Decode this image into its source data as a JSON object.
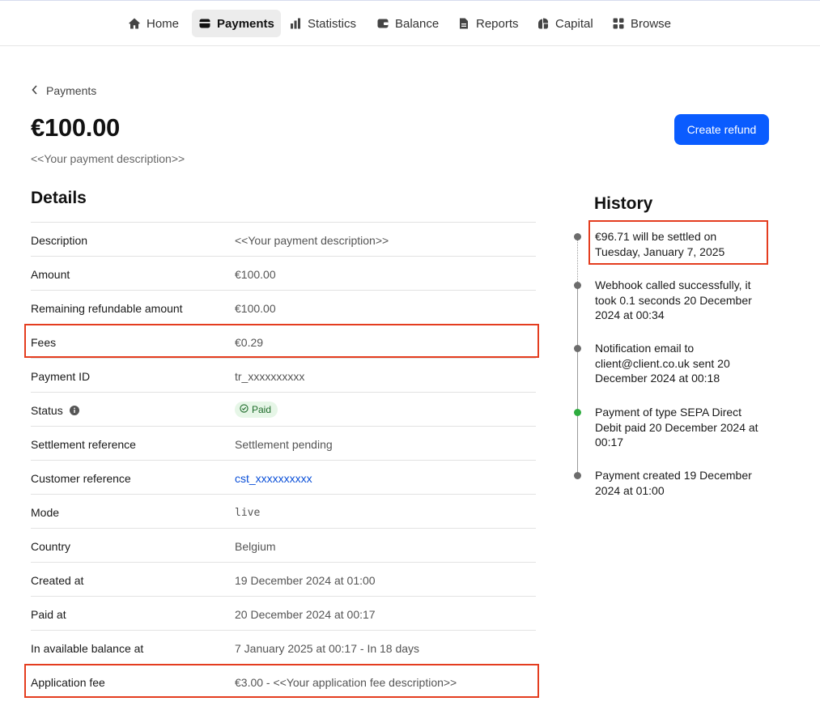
{
  "nav": {
    "items": [
      {
        "label": "Home",
        "icon": "home-icon"
      },
      {
        "label": "Payments",
        "icon": "payments-icon",
        "active": true
      },
      {
        "label": "Statistics",
        "icon": "statistics-icon"
      },
      {
        "label": "Balance",
        "icon": "balance-icon"
      },
      {
        "label": "Reports",
        "icon": "reports-icon"
      },
      {
        "label": "Capital",
        "icon": "capital-icon"
      },
      {
        "label": "Browse",
        "icon": "browse-icon"
      }
    ]
  },
  "header": {
    "back_label": "Payments",
    "amount": "€100.00",
    "description": "<<Your payment description>>",
    "refund_button": "Create refund"
  },
  "details": {
    "title": "Details",
    "rows": [
      {
        "label": "Description",
        "value": "<<Your payment description>>"
      },
      {
        "label": "Amount",
        "value": "€100.00"
      },
      {
        "label": "Remaining refundable amount",
        "value": "€100.00"
      },
      {
        "label": "Fees",
        "value": "€0.29"
      },
      {
        "label": "Payment ID",
        "value": "tr_xxxxxxxxxx"
      },
      {
        "label": "Status",
        "value": "Paid"
      },
      {
        "label": "Settlement reference",
        "value": "Settlement pending"
      },
      {
        "label": "Customer reference",
        "value": "cst_xxxxxxxxxx"
      },
      {
        "label": "Mode",
        "value": "live"
      },
      {
        "label": "Country",
        "value": "Belgium"
      },
      {
        "label": "Created at",
        "value": "19 December 2024 at 01:00"
      },
      {
        "label": "Paid at",
        "value": "20 December 2024 at 00:17"
      },
      {
        "label": "In available balance at",
        "value": "7 January 2025 at 00:17 - In 18 days"
      },
      {
        "label": "Application fee",
        "value": "€3.00 - <<Your application fee description>>"
      }
    ]
  },
  "history": {
    "title": "History",
    "events": [
      {
        "text": "€96.71 will be settled on Tuesday, January 7, 2025",
        "status": "pending"
      },
      {
        "text": "Webhook called successfully, it took 0.1 seconds 20 December 2024 at 00:34",
        "status": "done"
      },
      {
        "text": "Notification email to client@client.co.uk sent 20 December 2024 at 00:18",
        "status": "done"
      },
      {
        "text": "Payment of type SEPA Direct Debit paid 20 December 2024 at 00:17",
        "status": "success"
      },
      {
        "text": "Payment created 19 December 2024 at 01:00",
        "status": "done"
      }
    ]
  },
  "colors": {
    "accent": "#0a5cff",
    "highlight": "#e43d1f",
    "success": "#2eac3f"
  }
}
